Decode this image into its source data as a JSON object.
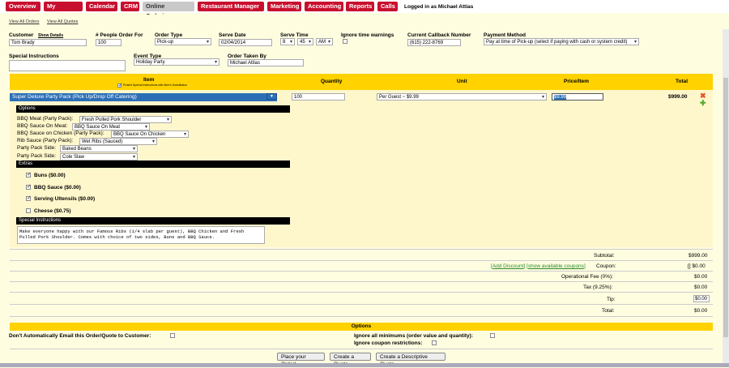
{
  "nav": {
    "tabs": [
      "Overview",
      "My Account",
      "Calendar",
      "CRM",
      "Online Ordering",
      "Restaurant Manager",
      "Marketing",
      "Accounting",
      "Reports",
      "Calls"
    ],
    "logged_in": "Logged in as Michael Attias"
  },
  "subnav": {
    "view_orders": "View All Orders",
    "view_quotes": "View All Quotes"
  },
  "form": {
    "customer_label": "Customer",
    "show_details": "Show Details",
    "customer_value": "Tom Brady",
    "people_label": "# People Order For",
    "people_value": "100",
    "order_type_label": "Order Type",
    "order_type_value": "Pick-up",
    "serve_date_label": "Serve Date",
    "serve_date_value": "02/04/2014",
    "serve_time_label": "Serve Time",
    "serve_hour": "8",
    "serve_minute": "45",
    "serve_ampm": "AM",
    "ignore_time_label": "Ignore time warnings",
    "callback_label": "Current Callback Number",
    "callback_value": "(615) 222-8769",
    "payment_label": "Payment Method",
    "payment_value": "Pay at time of Pick-up (select if paying with cash or system credit)",
    "special_instr_label": "Special Instructions",
    "event_type_label": "Event Type",
    "event_type_value": "Holiday Party",
    "taken_by_label": "Order Taken By",
    "taken_by_value": "Michael Attias"
  },
  "items_header": {
    "item": "Item",
    "item_note": "Protect Special Instructions with Item's Substitution",
    "quantity": "Quantity",
    "unit": "Unit",
    "price": "Price/Item",
    "total": "Total"
  },
  "item": {
    "name": "Super Deluxe Party Pack (Pick Up/Drop Off Catering)",
    "quantity": "100",
    "unit": "Per Guest ~ $9.99",
    "price": "$9.99",
    "total": "$999.00",
    "options_title": "Options",
    "options": [
      {
        "label": "BBQ Meat (Party Pack):",
        "value": "Fresh Pulled Pork Shoulder"
      },
      {
        "label": "BBQ Sauce On Meat:",
        "value": "BBQ Sauce On Meat"
      },
      {
        "label": "BBQ Sauce on Chicken (Party Pack):",
        "value": "BBQ Sauce On Chicken"
      },
      {
        "label": "Rib Sauce (Party Pack):",
        "value": "Wet Ribs (Sauced)"
      },
      {
        "label": "Party Pack Side:",
        "value": "Baked Beans"
      },
      {
        "label": "Party Pack Side:",
        "value": "Cole Slaw"
      }
    ],
    "extras_title": "Extras",
    "extras": [
      {
        "label": "Buns ($0.00)",
        "checked": true
      },
      {
        "label": "BBQ Sauce ($0.00)",
        "checked": true
      },
      {
        "label": "Serving Ultensils ($0.00)",
        "checked": true
      },
      {
        "label": "Cheese ($0.75)",
        "checked": false
      }
    ],
    "special_title": "Special Instructions",
    "special_text": "Make everyone happy with our Famous Ribs (1/4 slab per guest), BBQ Chicken and Fresh Pulled Pork Shoulder. Comes with choice of two sides, Buns and BBQ Sauce."
  },
  "totals": {
    "subtotal_label": "Subtotal:",
    "subtotal": "$999.00",
    "add_discount": "Add Discount",
    "show_coupons": "show available coupons",
    "coupon_label": "Coupon:",
    "coupon_value": "[] $0.00",
    "fee_label": "Operational Fee (0%):",
    "fee": "$0.00",
    "tax_label": "Tax (9.25%):",
    "tax": "$0.00",
    "tip_label": "Tip:",
    "tip": "$0.00",
    "total_label": "Total:",
    "total": "$0.00"
  },
  "options_section": {
    "title": "Options",
    "no_email": "Don't Automatically Email this Order/Quote to Customer:",
    "ignore_minimums": "Ignore all minimums (order value and quantity):",
    "ignore_coupon": "Ignore coupon restrictions:"
  },
  "buttons": {
    "place": "Place your Order!",
    "quote": "Create a Quote",
    "descriptive": "Create a Descriptive Quote"
  }
}
